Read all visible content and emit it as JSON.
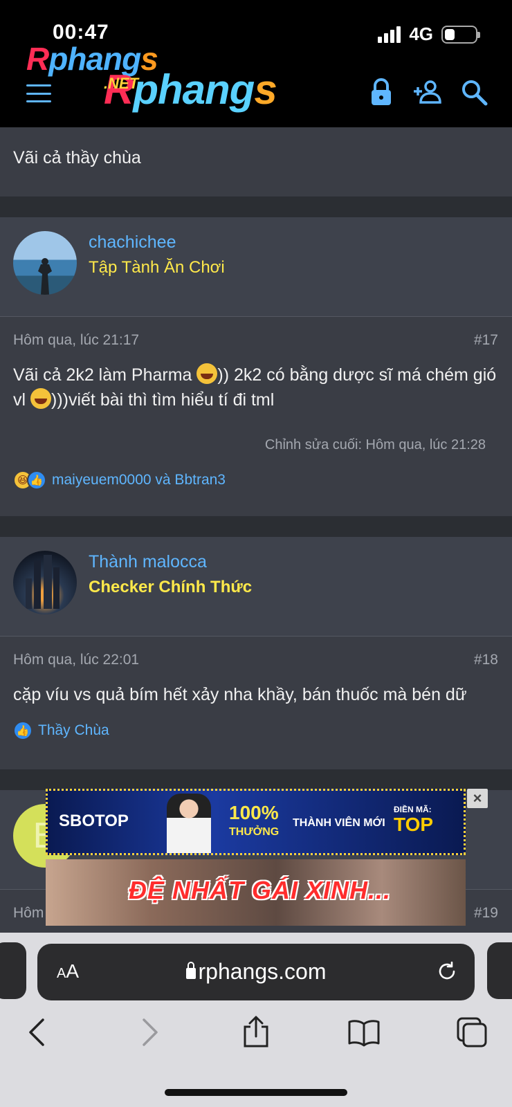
{
  "status": {
    "time": "00:47",
    "network": "4G"
  },
  "header": {
    "logo_small": {
      "r": "R",
      "rest": "phang",
      "s": "s"
    },
    "logo_big": {
      "net": ".NET",
      "r": "R",
      "rest": "phang",
      "s": "s"
    }
  },
  "posts": [
    {
      "text": "Vãi cả thầy chùa"
    },
    {
      "username": "chachichee",
      "title": "Tập Tành Ăn Chơi",
      "date": "Hôm qua, lúc 21:17",
      "number": "#17",
      "text_part1": "Vãi cả 2k2 làm Pharma ",
      "text_part2": ")) 2k2 có bằng dược sĩ má chém gió vl ",
      "text_part3": ")))viết bài thì tìm hiểu tí đi tml",
      "edited": "Chỉnh sửa cuối: Hôm qua, lúc 21:28",
      "reactions": "maiyeuem0000 và Bbtran3"
    },
    {
      "username": "Thành malocca",
      "title": "Checker Chính Thức",
      "date": "Hôm qua, lúc 22:01",
      "number": "#18",
      "text": "cặp víu vs quả bím hết xảy nha khầy, bán thuốc mà bén dữ",
      "reactions": "Thầy Chùa"
    },
    {
      "avatar_letter": "B",
      "date_partial": "Hôm",
      "number": "#19"
    }
  ],
  "ads": {
    "ad1": {
      "brand": "SBOTOP",
      "percent": "100%",
      "percent_sub": "THƯỞNG",
      "member": "THÀNH VIÊN MỚI",
      "code_label": "ĐIỀN MÃ:",
      "code": "TOP",
      "close": "×"
    },
    "ad2": {
      "text": "ĐỆ NHẤT GÁI XINH..."
    }
  },
  "browser": {
    "aa_small": "A",
    "aa_big": "A",
    "url": "rphangs.com"
  },
  "colors": {
    "link": "#5fb6ff",
    "usertitle": "#ffe94a",
    "background": "#2b2e33",
    "post": "#3a3d45"
  }
}
